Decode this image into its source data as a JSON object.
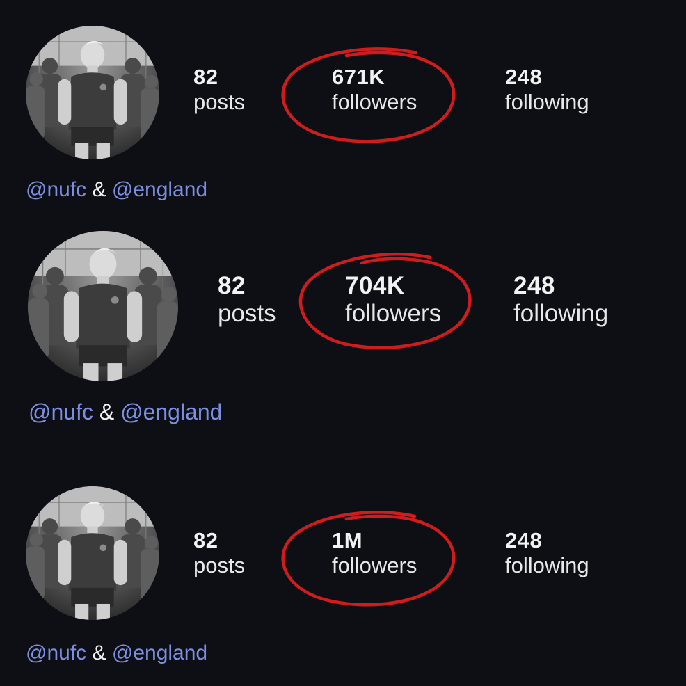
{
  "colors": {
    "background": "#0d0f15",
    "mention": "#7d8fe0",
    "annotation_circle": "#d01c1c",
    "text": "#f2f2f2"
  },
  "profiles": [
    {
      "avatar_icon": "profile-photo",
      "posts": {
        "value": "82",
        "label": "posts"
      },
      "followers": {
        "value": "671K",
        "label": "followers"
      },
      "following": {
        "value": "248",
        "label": "following"
      },
      "bio": {
        "mention1": "@nufc",
        "amp": "&",
        "mention2": "@england"
      }
    },
    {
      "avatar_icon": "profile-photo",
      "posts": {
        "value": "82",
        "label": "posts"
      },
      "followers": {
        "value": "704K",
        "label": "followers"
      },
      "following": {
        "value": "248",
        "label": "following"
      },
      "bio": {
        "mention1": "@nufc",
        "amp": "&",
        "mention2": "@england"
      }
    },
    {
      "avatar_icon": "profile-photo",
      "posts": {
        "value": "82",
        "label": "posts"
      },
      "followers": {
        "value": "1M",
        "label": "followers"
      },
      "following": {
        "value": "248",
        "label": "following"
      },
      "bio": {
        "mention1": "@nufc",
        "amp": "&",
        "mention2": "@england"
      }
    }
  ]
}
